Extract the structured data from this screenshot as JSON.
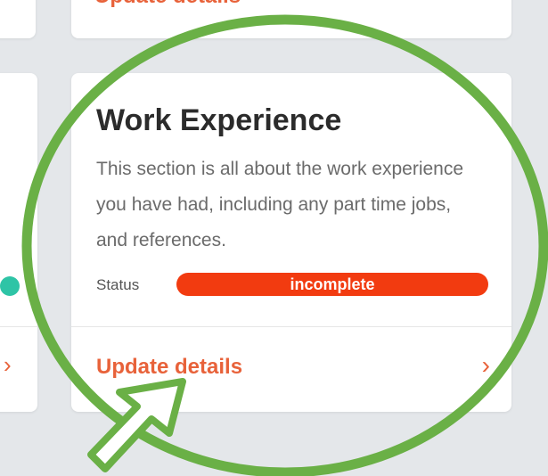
{
  "top_card": {
    "link_label": "Update details"
  },
  "card": {
    "title": "Work Experience",
    "description": "This section is all about the work experience you have had, including any part time jobs, and references.",
    "status_label": "Status",
    "status_value": "incomplete",
    "link_label": "Update details"
  },
  "icons": {
    "chevron": "chevron-right-icon",
    "cursor": "pointer-arrow-icon",
    "highlight": "highlight-circle"
  },
  "colors": {
    "accent": "#e8623a",
    "status_incomplete": "#f23b10",
    "highlight_ring": "#6ab046",
    "status_dot": "#2ec4a6"
  }
}
